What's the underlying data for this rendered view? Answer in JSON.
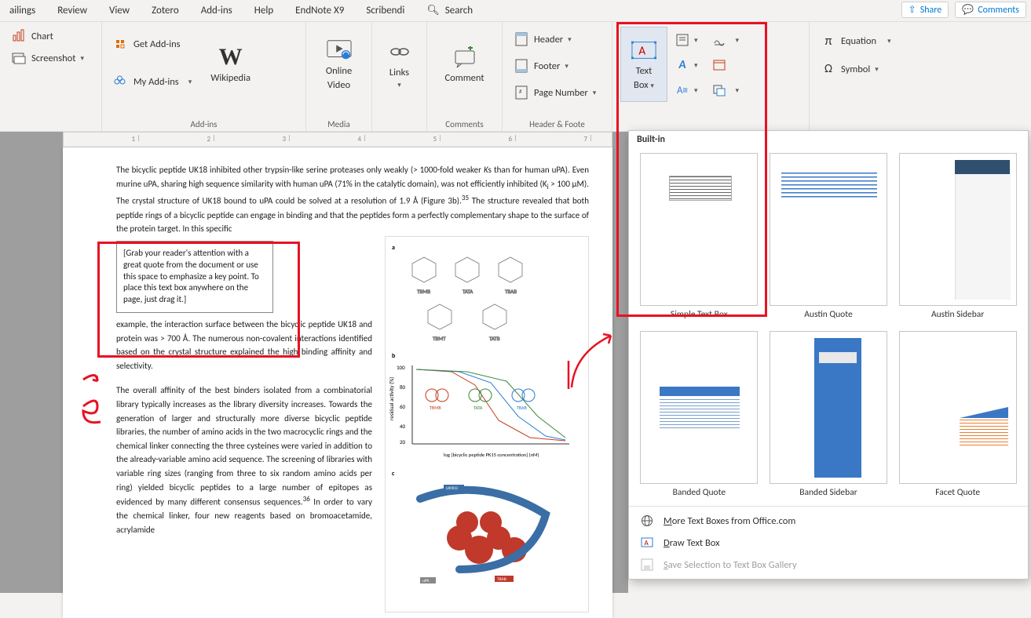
{
  "tabs": {
    "mailings": "ailings",
    "review": "Review",
    "view": "View",
    "zotero": "Zotero",
    "addins": "Add-ins",
    "help": "Help",
    "endnote": "EndNote X9",
    "scribendi": "Scribendi",
    "search": "Search"
  },
  "topright": {
    "share": "Share",
    "comments": "Comments"
  },
  "ribbon": {
    "chart": "Chart",
    "screenshot": "Screenshot",
    "getaddins": "Get Add-ins",
    "myaddins": "My Add-ins",
    "wikipedia": "Wikipedia",
    "onlinevideo_l1": "Online",
    "onlinevideo_l2": "Video",
    "links": "Links",
    "comment": "Comment",
    "header": "Header",
    "footer": "Footer",
    "pagenum": "Page Number",
    "textbox_l1": "Text",
    "textbox_l2": "Box",
    "equation": "Equation",
    "symbol": "Symbol",
    "group_addins": "Add-ins",
    "group_media": "Media",
    "group_comments": "Comments",
    "group_hf": "Header & Foote"
  },
  "gallery": {
    "header": "Built-in",
    "t0": "Simple Text Box",
    "t1": "Austin Quote",
    "t2": "Austin Sidebar",
    "t3": "Banded Quote",
    "t4": "Banded Sidebar",
    "t5": "Facet Quote",
    "more": "More Text Boxes from Office.com",
    "more_u": "M",
    "draw": "Draw Text Box",
    "draw_u": "D",
    "save": "Save Selection to Text Box Gallery",
    "save_u": "S"
  },
  "doc": {
    "p1a": "The bicyclic peptide UK18 inhibited other trypsin-like serine proteases only weakly (> 1000-fold weaker ",
    "p1b": "K",
    "p1b2": "s than for human uPA). Even murine uPA, sharing high sequence similarity with human uPA (71% in the catalytic domain), was not efficiently inhibited (K",
    "p1c": " > 100 μM). The crystal structure of UK18 bound to uPA could be solved at a resolution of 1.9 Å (Figure 3b).",
    "p1s": "35",
    "p1d": " The structure revealed that both peptide rings of a bicyclic peptide can engage in binding and that the peptides form a perfectly complementary shape to the surface of the protein target. In this specific",
    "callout": "[Grab your reader's attention with a great quote from the document or use this space to emphasize a key point. To place this text box anywhere on the page, just drag it.]",
    "p2": "example, the interaction surface between the bicyclic peptide UK18 and protein was > 700 Å. The numerous non-covalent interactions identified based on the crystal structure explained the high binding affinity and selectivity.",
    "p3a": "The overall affinity of the best binders isolated from a combinatorial library typically increases as the library diversity increases. Towards the generation of larger and structurally more diverse bicyclic peptide libraries, the number of amino acids in the two macrocyclic rings and the chemical linker connecting the three cysteines were varied in addition to the already-variable amino acid sequence. The screening of libraries with variable ring sizes (ranging from three to six random amino acids per ring) yielded bicyclic peptides to a large number of epitopes as evidenced by many different consensus sequences.",
    "p3s": "36",
    "p3b": " In order to vary the chemical linker, four new reagents based on bromoacetamide, acrylamide",
    "fig_labels": {
      "a": "a",
      "b": "b",
      "c": "c",
      "tbmb": "TBMB",
      "tata": "TATA",
      "tbab": "TBAB",
      "tbmt": "TBMT",
      "tatb": "TATB",
      "xaxis": "log [bicyclic peptide PK15 concentration] (nM)",
      "yaxis": "residual activity (%)",
      "upa": "uPA",
      "uk903": "UK903"
    }
  }
}
